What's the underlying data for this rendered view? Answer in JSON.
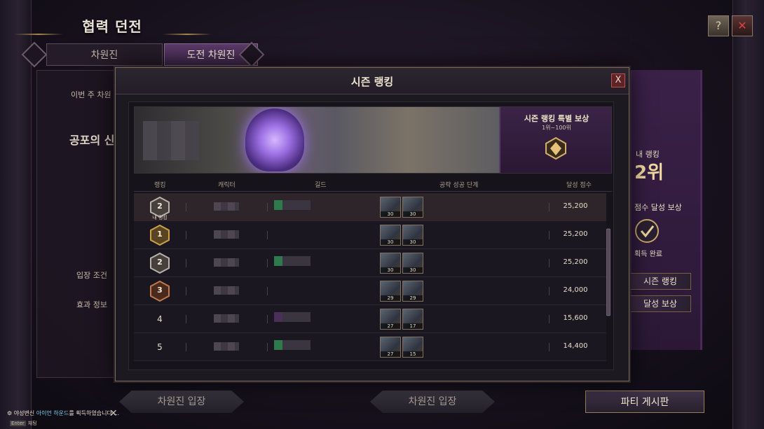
{
  "window": {
    "title": "협력 던전",
    "tabs": [
      {
        "label": "차원진",
        "active": false
      },
      {
        "label": "도전 차원진",
        "active": true
      }
    ],
    "help_icon": "question-book-icon",
    "close_icon": "close-icon"
  },
  "left_panel": {
    "weekly_label": "이번 주 차원",
    "dungeon_title": "공포의 신",
    "entry_condition": "입장 조건",
    "effect_info": "효과 정보"
  },
  "right_panel": {
    "my_ranking_label": "내 랭킹",
    "my_rank_value": "2위",
    "score_reward_label": "점수 달성 보상",
    "claimed_label": "획득 완료",
    "season_ranking_button": "시즌 랭킹",
    "achievement_reward_button": "달성 보상"
  },
  "bottom": {
    "enter_button_1": "차원진 입장",
    "enter_button_2": "차원진 입장",
    "party_board_button": "파티 게시판"
  },
  "notification": {
    "prefix": "야성변신 ",
    "highlight": "아이언 하운드",
    "suffix": "를 획득하였습니다 ...",
    "key_hint": "Enter",
    "key_action": "채팅"
  },
  "modal": {
    "title": "시즌 랭킹",
    "close_label": "X",
    "reward": {
      "title": "시즌 랭킹 특별 보상",
      "subtitle": "1위~100위"
    },
    "columns": {
      "rank": "랭킹",
      "character": "캐릭터",
      "guild": "길드",
      "stage": "공략 성공 단계",
      "score": "달성 점수"
    },
    "my_ranking_label": "내 랭킹",
    "rows": [
      {
        "rank": "2",
        "badge": "silver",
        "is_me": true,
        "stages": [
          "30",
          "30"
        ],
        "score": "25,200"
      },
      {
        "rank": "1",
        "badge": "gold",
        "is_me": false,
        "stages": [
          "30",
          "30"
        ],
        "score": "25,200"
      },
      {
        "rank": "2",
        "badge": "silver",
        "is_me": false,
        "stages": [
          "30",
          "30"
        ],
        "score": "25,200"
      },
      {
        "rank": "3",
        "badge": "bronze",
        "is_me": false,
        "stages": [
          "29",
          "29"
        ],
        "score": "24,000"
      },
      {
        "rank": "4",
        "badge": "none",
        "is_me": false,
        "stages": [
          "27",
          "17"
        ],
        "score": "15,600"
      },
      {
        "rank": "5",
        "badge": "none",
        "is_me": false,
        "stages": [
          "27",
          "15"
        ],
        "score": "14,400"
      }
    ]
  },
  "colors": {
    "accent_purple": "#3e2548",
    "gold": "#a8874d",
    "close_red": "#c05050"
  }
}
